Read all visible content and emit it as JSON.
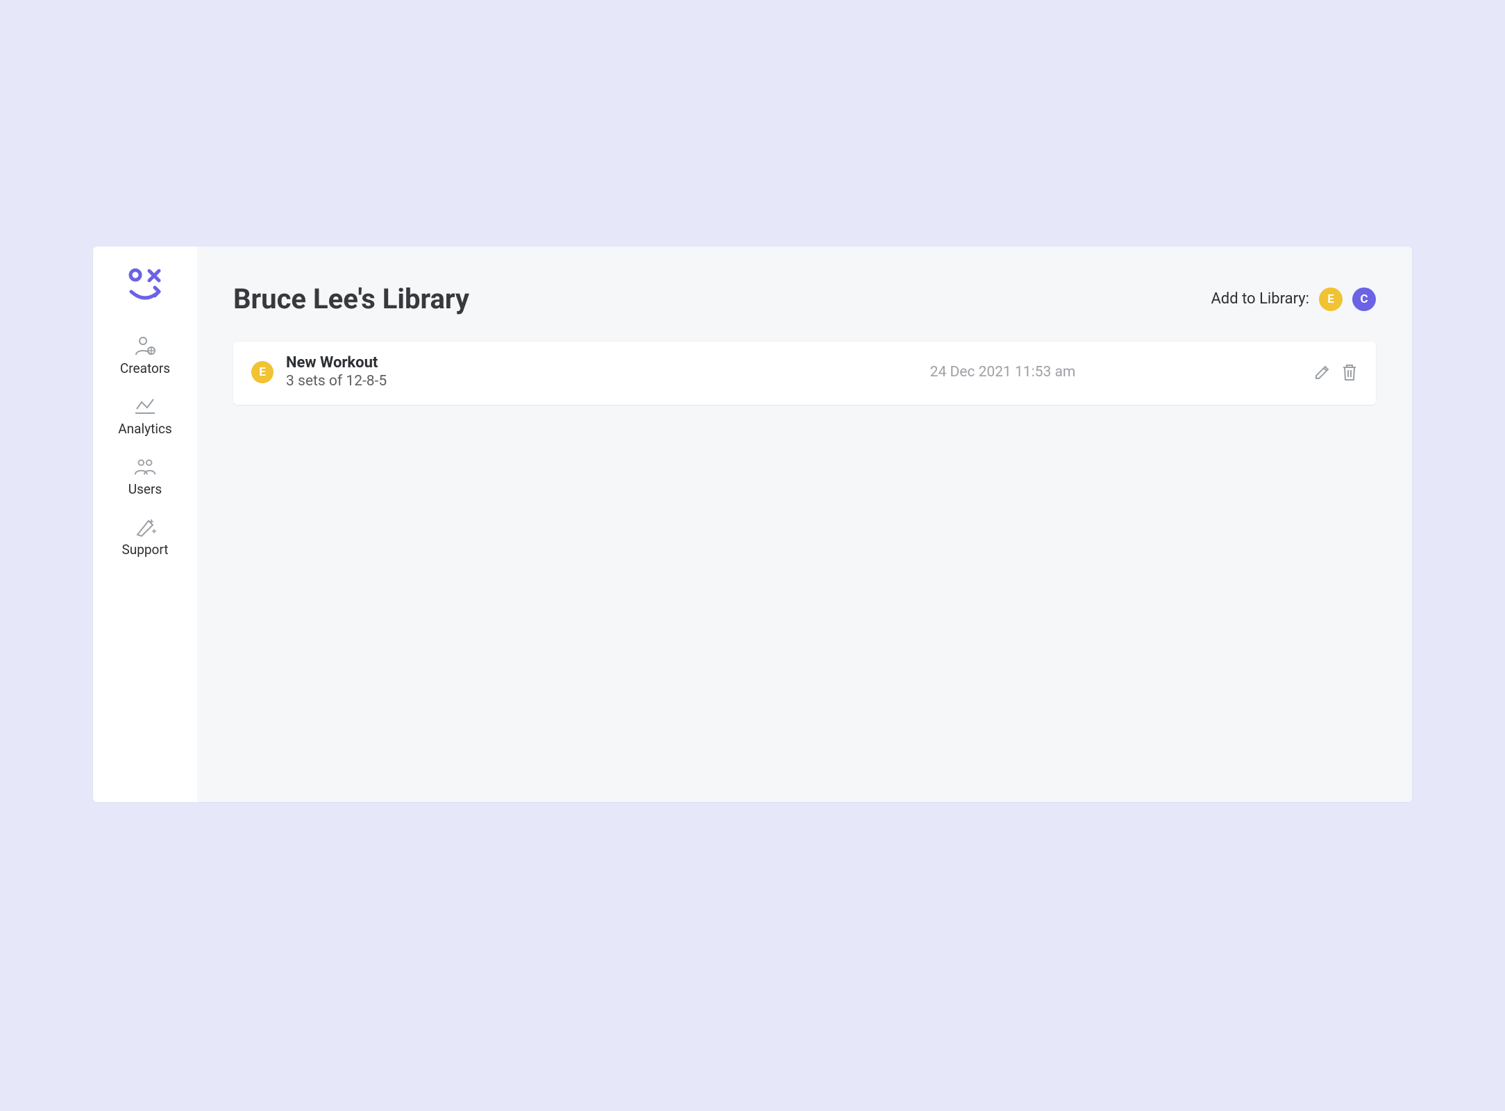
{
  "sidebar": {
    "items": [
      {
        "label": "Creators"
      },
      {
        "label": "Analytics"
      },
      {
        "label": "Users"
      },
      {
        "label": "Support"
      }
    ]
  },
  "header": {
    "title": "Bruce Lee's Library",
    "add_label": "Add to Library:",
    "chips": [
      {
        "letter": "E",
        "color": "yellow"
      },
      {
        "letter": "C",
        "color": "purple"
      }
    ]
  },
  "items": [
    {
      "badge": "E",
      "title": "New Workout",
      "subtitle": "3 sets of 12-8-5",
      "date": "24 Dec 2021 11:53 am"
    }
  ]
}
